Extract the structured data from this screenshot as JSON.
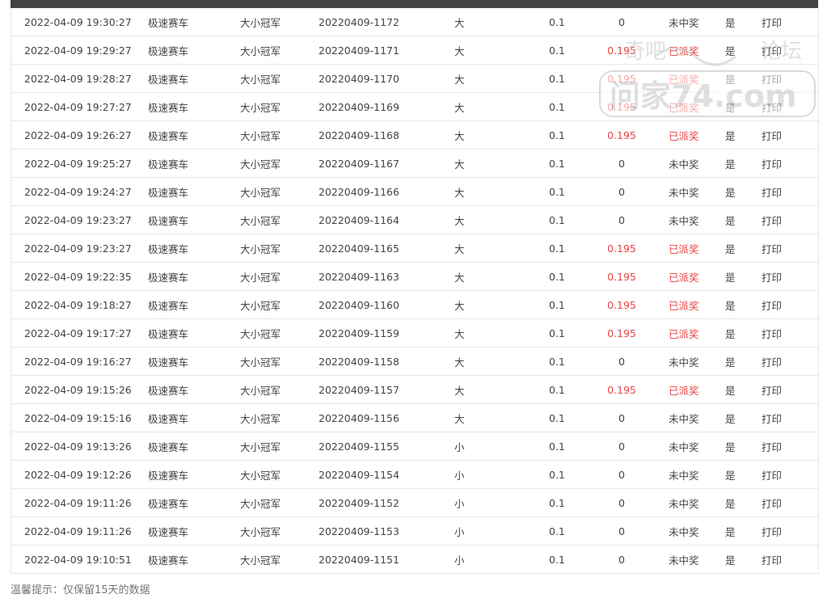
{
  "table": {
    "rows": [
      {
        "time": "2022-04-09 19:30:27",
        "game": "极速赛车",
        "play": "大小冠军",
        "issue": "20220409-1172",
        "pick": "大",
        "amount": "0.1",
        "win": "0",
        "status": "未中奖",
        "won": false,
        "flag": "是",
        "action": "打印"
      },
      {
        "time": "2022-04-09 19:29:27",
        "game": "极速赛车",
        "play": "大小冠军",
        "issue": "20220409-1171",
        "pick": "大",
        "amount": "0.1",
        "win": "0.195",
        "status": "已派奖",
        "won": true,
        "flag": "是",
        "action": "打印"
      },
      {
        "time": "2022-04-09 19:28:27",
        "game": "极速赛车",
        "play": "大小冠军",
        "issue": "20220409-1170",
        "pick": "大",
        "amount": "0.1",
        "win": "0.195",
        "status": "已派奖",
        "won": true,
        "flag": "是",
        "action": "打印"
      },
      {
        "time": "2022-04-09 19:27:27",
        "game": "极速赛车",
        "play": "大小冠军",
        "issue": "20220409-1169",
        "pick": "大",
        "amount": "0.1",
        "win": "0.195",
        "status": "已派奖",
        "won": true,
        "flag": "是",
        "action": "打印"
      },
      {
        "time": "2022-04-09 19:26:27",
        "game": "极速赛车",
        "play": "大小冠军",
        "issue": "20220409-1168",
        "pick": "大",
        "amount": "0.1",
        "win": "0.195",
        "status": "已派奖",
        "won": true,
        "flag": "是",
        "action": "打印"
      },
      {
        "time": "2022-04-09 19:25:27",
        "game": "极速赛车",
        "play": "大小冠军",
        "issue": "20220409-1167",
        "pick": "大",
        "amount": "0.1",
        "win": "0",
        "status": "未中奖",
        "won": false,
        "flag": "是",
        "action": "打印"
      },
      {
        "time": "2022-04-09 19:24:27",
        "game": "极速赛车",
        "play": "大小冠军",
        "issue": "20220409-1166",
        "pick": "大",
        "amount": "0.1",
        "win": "0",
        "status": "未中奖",
        "won": false,
        "flag": "是",
        "action": "打印"
      },
      {
        "time": "2022-04-09 19:23:27",
        "game": "极速赛车",
        "play": "大小冠军",
        "issue": "20220409-1164",
        "pick": "大",
        "amount": "0.1",
        "win": "0",
        "status": "未中奖",
        "won": false,
        "flag": "是",
        "action": "打印"
      },
      {
        "time": "2022-04-09 19:23:27",
        "game": "极速赛车",
        "play": "大小冠军",
        "issue": "20220409-1165",
        "pick": "大",
        "amount": "0.1",
        "win": "0.195",
        "status": "已派奖",
        "won": true,
        "flag": "是",
        "action": "打印"
      },
      {
        "time": "2022-04-09 19:22:35",
        "game": "极速赛车",
        "play": "大小冠军",
        "issue": "20220409-1163",
        "pick": "大",
        "amount": "0.1",
        "win": "0.195",
        "status": "已派奖",
        "won": true,
        "flag": "是",
        "action": "打印"
      },
      {
        "time": "2022-04-09 19:18:27",
        "game": "极速赛车",
        "play": "大小冠军",
        "issue": "20220409-1160",
        "pick": "大",
        "amount": "0.1",
        "win": "0.195",
        "status": "已派奖",
        "won": true,
        "flag": "是",
        "action": "打印"
      },
      {
        "time": "2022-04-09 19:17:27",
        "game": "极速赛车",
        "play": "大小冠军",
        "issue": "20220409-1159",
        "pick": "大",
        "amount": "0.1",
        "win": "0.195",
        "status": "已派奖",
        "won": true,
        "flag": "是",
        "action": "打印"
      },
      {
        "time": "2022-04-09 19:16:27",
        "game": "极速赛车",
        "play": "大小冠军",
        "issue": "20220409-1158",
        "pick": "大",
        "amount": "0.1",
        "win": "0",
        "status": "未中奖",
        "won": false,
        "flag": "是",
        "action": "打印"
      },
      {
        "time": "2022-04-09 19:15:26",
        "game": "极速赛车",
        "play": "大小冠军",
        "issue": "20220409-1157",
        "pick": "大",
        "amount": "0.1",
        "win": "0.195",
        "status": "已派奖",
        "won": true,
        "flag": "是",
        "action": "打印"
      },
      {
        "time": "2022-04-09 19:15:16",
        "game": "极速赛车",
        "play": "大小冠军",
        "issue": "20220409-1156",
        "pick": "大",
        "amount": "0.1",
        "win": "0",
        "status": "未中奖",
        "won": false,
        "flag": "是",
        "action": "打印"
      },
      {
        "time": "2022-04-09 19:13:26",
        "game": "极速赛车",
        "play": "大小冠军",
        "issue": "20220409-1155",
        "pick": "小",
        "amount": "0.1",
        "win": "0",
        "status": "未中奖",
        "won": false,
        "flag": "是",
        "action": "打印"
      },
      {
        "time": "2022-04-09 19:12:26",
        "game": "极速赛车",
        "play": "大小冠军",
        "issue": "20220409-1154",
        "pick": "小",
        "amount": "0.1",
        "win": "0",
        "status": "未中奖",
        "won": false,
        "flag": "是",
        "action": "打印"
      },
      {
        "time": "2022-04-09 19:11:26",
        "game": "极速赛车",
        "play": "大小冠军",
        "issue": "20220409-1152",
        "pick": "小",
        "amount": "0.1",
        "win": "0",
        "status": "未中奖",
        "won": false,
        "flag": "是",
        "action": "打印"
      },
      {
        "time": "2022-04-09 19:11:26",
        "game": "极速赛车",
        "play": "大小冠军",
        "issue": "20220409-1153",
        "pick": "小",
        "amount": "0.1",
        "win": "0",
        "status": "未中奖",
        "won": false,
        "flag": "是",
        "action": "打印"
      },
      {
        "time": "2022-04-09 19:10:51",
        "game": "极速赛车",
        "play": "大小冠军",
        "issue": "20220409-1151",
        "pick": "小",
        "amount": "0.1",
        "win": "0",
        "status": "未中奖",
        "won": false,
        "flag": "是",
        "action": "打印"
      }
    ]
  },
  "footer": {
    "tip": "温馨提示：仅保留15天的数据"
  },
  "watermark": {
    "line1": "奇吧",
    "line2": "论坛",
    "line3": "问家74.com"
  },
  "colors": {
    "win_red": "#e64545",
    "header_dark": "#444444",
    "border": "#e6e6e6"
  }
}
